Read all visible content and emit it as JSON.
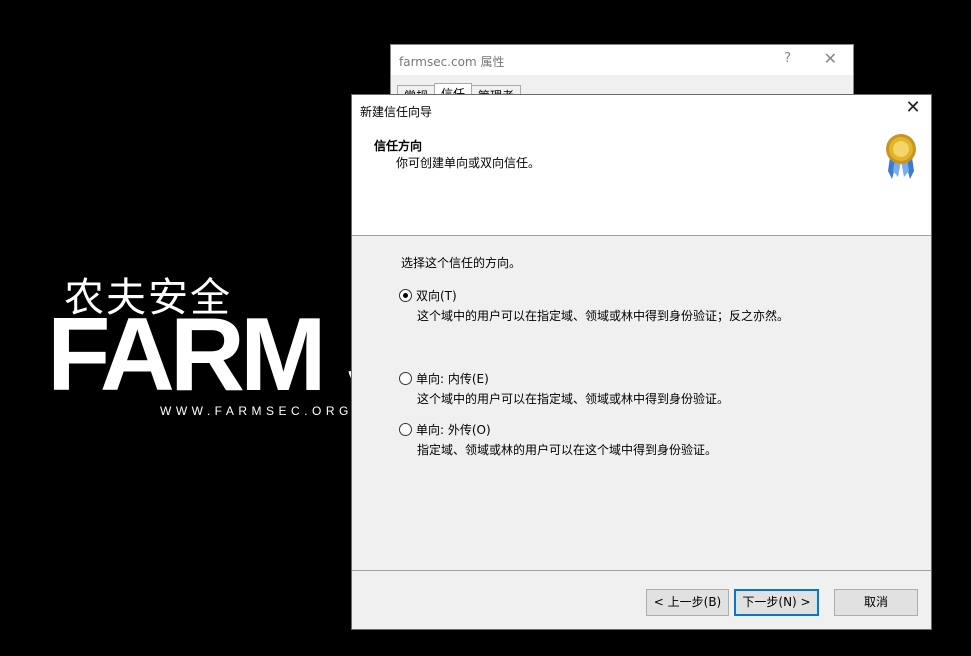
{
  "logo": {
    "chinese_text": "农夫安全",
    "brand_text": "FARM S",
    "url_text": "WWW.FARMSEC.ORG"
  },
  "properties_window": {
    "title": "farmsec.com 属性",
    "help_label": "?",
    "close_label": "✕",
    "tabs": [
      "常规",
      "信任",
      "管理者"
    ],
    "active_tab_index": 1
  },
  "wizard": {
    "title": "新建信任向导",
    "close_label": "✕",
    "header": {
      "title": "信任方向",
      "subtitle": "你可创建单向或双向信任。",
      "icon": "award-ribbon-icon"
    },
    "prompt": "选择这个信任的方向。",
    "options": [
      {
        "label": "双向(T)",
        "description": "这个域中的用户可以在指定域、领域或林中得到身份验证；反之亦然。",
        "checked": true
      },
      {
        "label": "单向: 内传(E)",
        "description": "这个域中的用户可以在指定域、领域或林中得到身份验证。",
        "checked": false
      },
      {
        "label": "单向: 外传(O)",
        "description": "指定域、领域或林的用户可以在这个域中得到身份验证。",
        "checked": false
      }
    ],
    "buttons": {
      "back": "< 上一步(B)",
      "next": "下一步(N) >",
      "cancel": "取消"
    }
  },
  "colors": {
    "background": "#000000",
    "dialog_bg": "#f0f0f0",
    "default_button_border": "#0078d7",
    "badge_gold": "#e0b52a",
    "badge_ribbon": "#3d7bd0"
  }
}
